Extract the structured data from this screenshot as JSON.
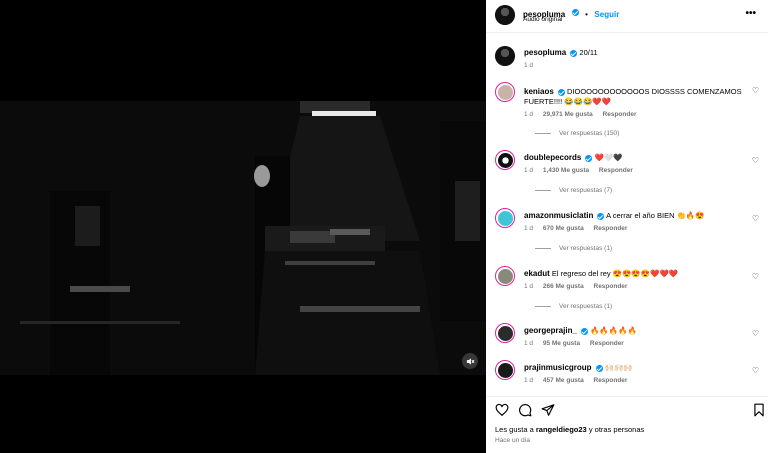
{
  "post": {
    "author": "pesopluma",
    "follow_label": "Seguir",
    "audio": "Audio original",
    "more": "•••",
    "caption": "20/11",
    "caption_time": "1 d"
  },
  "comments": [
    {
      "user": "keniaos",
      "verified": true,
      "text": "DIOOOOOOOOOOOOS DIOSSSS COMENZAMOS FUERTE!!!! 😂😂😂❤️❤️",
      "time": "1 d",
      "likes": "29,971 Me gusta",
      "reply": "Responder",
      "replies": "Ver respuestas (150)"
    },
    {
      "user": "doublepecords",
      "verified": true,
      "text": "❤️🤍🖤",
      "time": "1 d",
      "likes": "1,430 Me gusta",
      "reply": "Responder",
      "replies": "Ver respuestas (7)"
    },
    {
      "user": "amazonmusiclatin",
      "verified": true,
      "text": "A cerrar el año BIEN 👏🔥😍",
      "time": "1 d",
      "likes": "670 Me gusta",
      "reply": "Responder",
      "replies": "Ver respuestas (1)"
    },
    {
      "user": "ekadut",
      "verified": false,
      "text": "El regreso del rey 😍😍😍😍❤️❤️❤️",
      "time": "1 d",
      "likes": "266 Me gusta",
      "reply": "Responder",
      "replies": "Ver respuestas (1)"
    },
    {
      "user": "georgeprajin_",
      "verified": true,
      "text": "🔥🔥🔥🔥🔥",
      "time": "1 d",
      "likes": "95 Me gusta",
      "reply": "Responder",
      "replies": ""
    },
    {
      "user": "prajinmusicgroup",
      "verified": true,
      "text": "🙌🏻🙌🏻🙌🏻",
      "time": "1 d",
      "likes": "457 Me gusta",
      "reply": "Responder",
      "replies": ""
    }
  ],
  "footer": {
    "likes_prefix": "Les gusta a ",
    "likes_user": "rangeldiego23",
    "likes_suffix": " y otras personas",
    "time": "Hace un día"
  },
  "icons": {
    "heart": "heart-icon",
    "comment": "comment-icon",
    "share": "share-icon",
    "save": "bookmark-icon",
    "mute": "mute-icon"
  }
}
